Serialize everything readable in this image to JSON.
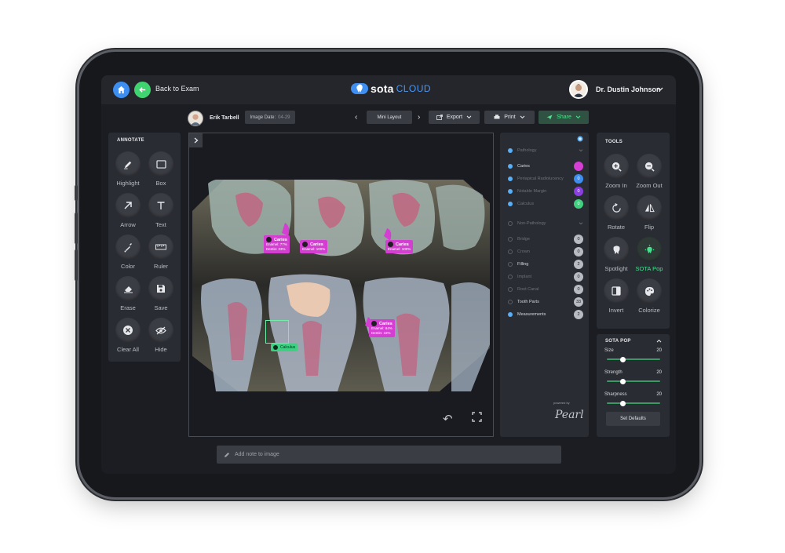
{
  "topbar": {
    "back_label": "Back to Exam",
    "logo_main": "sota",
    "logo_sub": "CLOUD",
    "user_name": "Dr. Dustin Johnson"
  },
  "subbar": {
    "patient_name": "Erik Tarbell",
    "image_date_label": "Image Date:",
    "image_date_value": "04-29",
    "mini_layout": "Mini Layout",
    "export_label": "Export",
    "print_label": "Print",
    "share_label": "Share"
  },
  "annotate": {
    "title": "ANNOTATE",
    "tools": [
      "Highlight",
      "Box",
      "Arrow",
      "Text",
      "Color",
      "Ruler",
      "Erase",
      "Save",
      "Clear All",
      "Hide"
    ]
  },
  "findings": [
    {
      "title": "Caries",
      "line1": "Enamel: 77%",
      "line2": "Dentin: 23%"
    },
    {
      "title": "Caries",
      "line1": "Enamel: 100%",
      "line2": ""
    },
    {
      "title": "Caries",
      "line1": "Enamel: 100%",
      "line2": ""
    },
    {
      "title": "Caries",
      "line1": "Enamel: 84%",
      "line2": "Dentin: 16%"
    }
  ],
  "calculus_tag": "Calculus",
  "pathology": {
    "header": "Pathology",
    "items": [
      {
        "label": "Caries",
        "count": "",
        "color": "#d63fd6"
      },
      {
        "label": "Periapical Radiolucency",
        "count": "0",
        "color": "#3d8ef0"
      },
      {
        "label": "Notable Margin",
        "count": "0",
        "color": "#8a3fe0"
      },
      {
        "label": "Calculus",
        "count": "0",
        "color": "#3fd17f"
      }
    ]
  },
  "non_pathology": {
    "header": "Non-Pathology",
    "items": [
      {
        "label": "Bridge",
        "count": "0"
      },
      {
        "label": "Crown",
        "count": "0"
      },
      {
        "label": "Filling",
        "count": "2"
      },
      {
        "label": "Implant",
        "count": "0"
      },
      {
        "label": "Root Canal",
        "count": "0"
      },
      {
        "label": "Tooth Parts",
        "count": "33"
      },
      {
        "label": "Measurements",
        "count": "2"
      }
    ]
  },
  "powered_by": "powered by",
  "pearl_logo": "Pearl",
  "tools": {
    "title": "TOOLS",
    "items": [
      "Zoom In",
      "Zoom Out",
      "Rotate",
      "Flip",
      "Spotlight",
      "SOTA Pop",
      "Invert",
      "Colorize"
    ]
  },
  "sota_pop": {
    "title": "SOTA POP",
    "sliders": [
      {
        "label": "Size",
        "value": "20",
        "level": 0.3
      },
      {
        "label": "Strength",
        "value": "20",
        "level": 0.3
      },
      {
        "label": "Sharpness",
        "value": "20",
        "level": 0.3
      }
    ],
    "defaults_label": "Set Defaults"
  },
  "note": {
    "placeholder": "Add note to image"
  },
  "colors": {
    "accent_green": "#3fd46f",
    "accent_blue": "#3d8ef0",
    "caries": "#d43fd2"
  }
}
